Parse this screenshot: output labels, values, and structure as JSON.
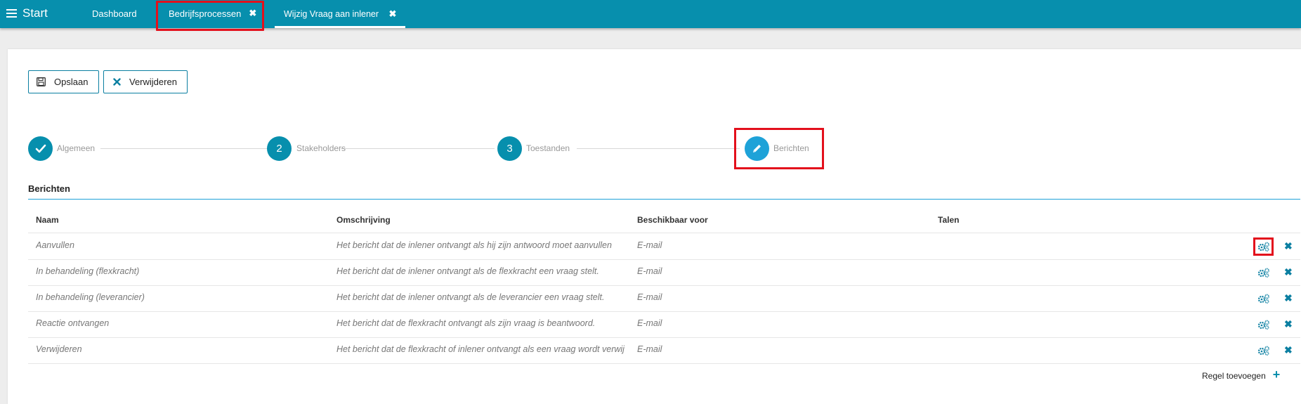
{
  "topbar": {
    "start_label": "Start",
    "tabs": [
      {
        "label": "Dashboard"
      },
      {
        "label": "Bedrijfsprocessen",
        "close": "✖"
      },
      {
        "label": "Wijzig Vraag aan inlener",
        "close": "✖"
      }
    ]
  },
  "toolbar": {
    "save_label": "Opslaan",
    "delete_label": "Verwijderen"
  },
  "steps": [
    {
      "label": "Algemeen",
      "marker": "check-icon",
      "state": "done"
    },
    {
      "label": "Stakeholders",
      "marker": "2",
      "state": "done"
    },
    {
      "label": "Toestanden",
      "marker": "3",
      "state": "done"
    },
    {
      "label": "Berichten",
      "marker": "pencil-icon",
      "state": "active"
    }
  ],
  "section": {
    "title": "Berichten"
  },
  "table": {
    "columns": [
      "Naam",
      "Omschrijving",
      "Beschikbaar voor",
      "Talen"
    ],
    "rows": [
      {
        "naam": "Aanvullen",
        "omschrijving": "Het bericht dat de inlener ontvangt als hij zijn antwoord moet aanvullen",
        "beschikbaar": "E-mail",
        "talen": ""
      },
      {
        "naam": "In behandeling (flexkracht)",
        "omschrijving": "Het bericht dat de inlener ontvangt als de flexkracht een vraag stelt.",
        "beschikbaar": "E-mail",
        "talen": ""
      },
      {
        "naam": "In behandeling (leverancier)",
        "omschrijving": "Het bericht dat de inlener ontvangt als de leverancier een vraag stelt.",
        "beschikbaar": "E-mail",
        "talen": ""
      },
      {
        "naam": "Reactie ontvangen",
        "omschrijving": "Het bericht dat de flexkracht ontvangt als zijn vraag is beantwoord.",
        "beschikbaar": "E-mail",
        "talen": ""
      },
      {
        "naam": "Verwijderen",
        "omschrijving": "Het bericht dat de flexkracht of inlener ontvangt als een vraag wordt verwijderd",
        "beschikbaar": "E-mail",
        "talen": ""
      }
    ],
    "add_row_label": "Regel toevoegen"
  },
  "colors": {
    "topbar": "#078fad",
    "accent": "#0b7fa1",
    "active_step": "#1ea2d8",
    "highlight": "#e3101c"
  }
}
